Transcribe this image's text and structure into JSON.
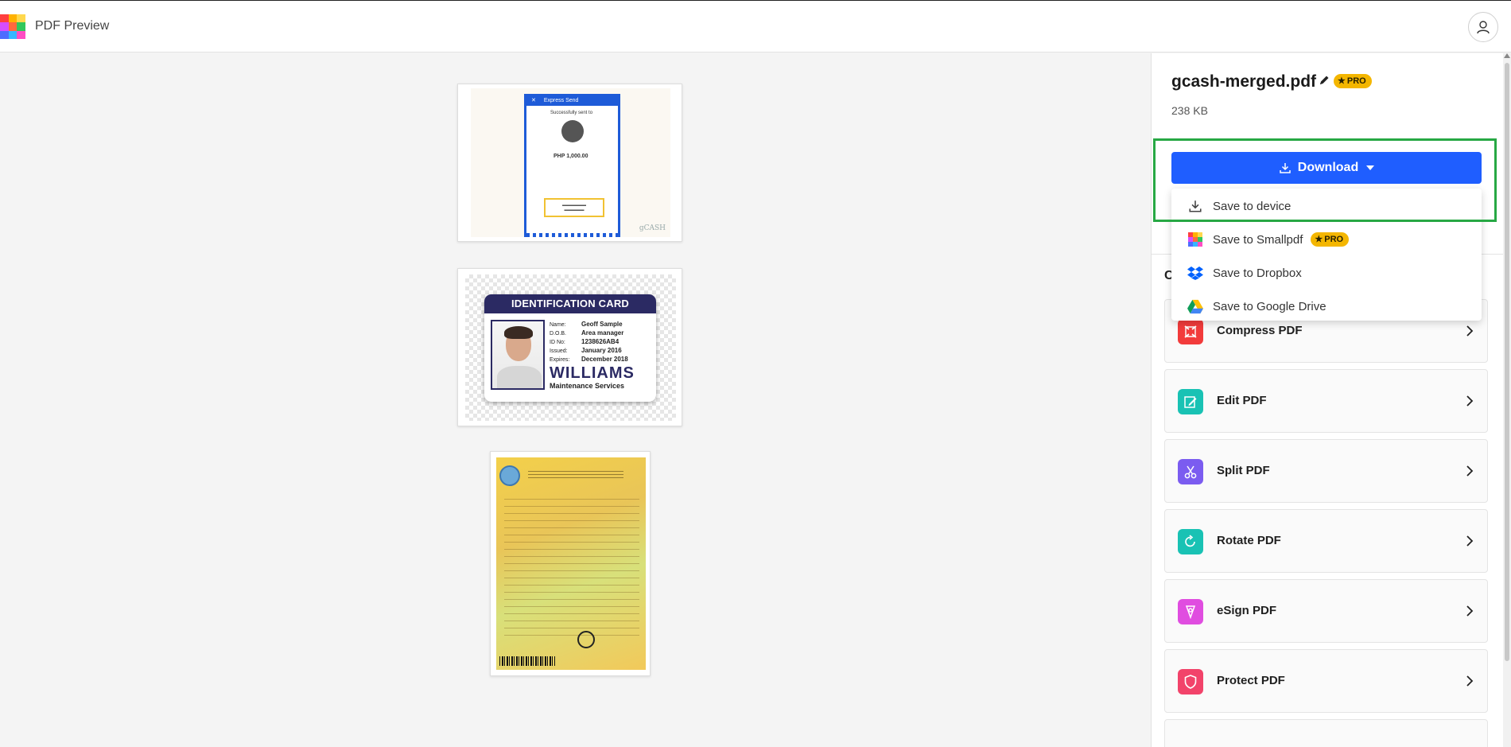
{
  "app": {
    "title": "PDF Preview",
    "logo_colors": [
      "#ff3f3f",
      "#ffb200",
      "#ffd84d",
      "#d64dff",
      "#ff6a3d",
      "#31c75b",
      "#4d6dff",
      "#36b7ff",
      "#ff4dc4"
    ]
  },
  "header": {
    "account_icon": "user-icon"
  },
  "preview": {
    "pages": [
      {
        "kind": "receipt",
        "header_text": "Express Send",
        "sent_to": "Successfully sent to",
        "amount": "PHP 1,000.00",
        "watermark": "gCASH"
      },
      {
        "kind": "id-card",
        "card_title": "IDENTIFICATION CARD",
        "fields": [
          {
            "key": "Name:",
            "value": "Geoff Sample"
          },
          {
            "key": "D.O.B.",
            "value": "Area manager"
          },
          {
            "key": "ID No:",
            "value": "1238626AB4"
          },
          {
            "key": "Issued:",
            "value": "January 2016"
          },
          {
            "key": "Expires:",
            "value": "December 2018"
          }
        ],
        "company": "WILLIAMS",
        "company_sub": "Maintenance Services"
      },
      {
        "kind": "certificate"
      }
    ]
  },
  "sidebar": {
    "file_name": "gcash-merged.pdf",
    "pro_label": "PRO",
    "file_size": "238 KB",
    "download_label": "Download",
    "menu": [
      {
        "label": "Save to device",
        "icon": "download-icon",
        "pro": false
      },
      {
        "label": "Save to Smallpdf",
        "icon": "smallpdf-icon",
        "pro": true
      },
      {
        "label": "Save to Dropbox",
        "icon": "dropbox-icon",
        "pro": false
      },
      {
        "label": "Save to Google Drive",
        "icon": "google-drive-icon",
        "pro": false
      }
    ],
    "section_letter": "C",
    "tools": [
      {
        "label": "Compress PDF",
        "icon": "compress-icon",
        "color": "#f23b3b"
      },
      {
        "label": "Edit PDF",
        "icon": "edit-icon",
        "color": "#19c2b4"
      },
      {
        "label": "Split PDF",
        "icon": "scissors-icon",
        "color": "#7b5cf0"
      },
      {
        "label": "Rotate PDF",
        "icon": "rotate-icon",
        "color": "#19c2b4"
      },
      {
        "label": "eSign PDF",
        "icon": "esign-icon",
        "color": "#e04de0"
      },
      {
        "label": "Protect PDF",
        "icon": "shield-icon",
        "color": "#f2436a"
      }
    ]
  },
  "colors": {
    "accent": "#1f5eff",
    "pro_badge": "#f4b600",
    "highlight": "#27a844"
  }
}
